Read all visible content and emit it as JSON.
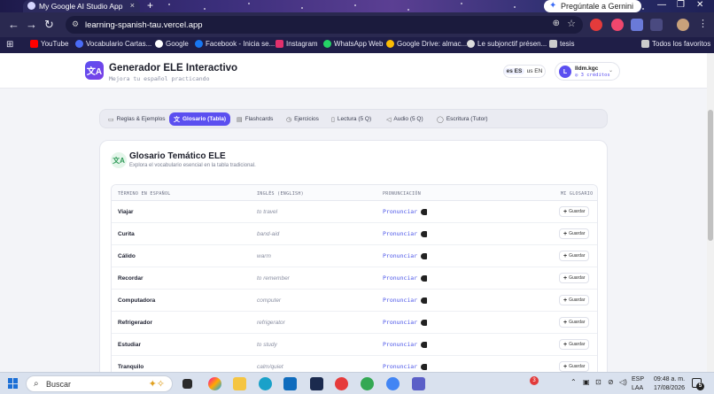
{
  "browser": {
    "tab_title": "My Google AI Studio App",
    "tab_close": "×",
    "new_tab": "+",
    "gemini_button": "Pregúntale a Gemini",
    "url": "learning-spanish-tau.vercel.app",
    "bookmarks": [
      {
        "label": "YouTube",
        "color": "#ff0000"
      },
      {
        "label": "Vocabulario Cartas...",
        "color": "#4a6cf7"
      },
      {
        "label": "Google",
        "color": "#ffffff"
      },
      {
        "label": "Facebook - Inicia se...",
        "color": "#1877f2"
      },
      {
        "label": "Instagram",
        "color": "#e1306c"
      },
      {
        "label": "WhatsApp Web",
        "color": "#25d366"
      },
      {
        "label": "Google Drive: almac...",
        "color": "#fbbc04"
      },
      {
        "label": "Le subjonctif présen...",
        "color": "#dddddd"
      },
      {
        "label": "tesis",
        "color": "#cccccc"
      }
    ],
    "all_bookmarks": "Todos los favoritos"
  },
  "app": {
    "title": "Generador ELE Interactivo",
    "subtitle": "Mejora tu español practicando",
    "logo_glyph": "文A",
    "lang_es": "es ES",
    "lang_en": "us EN",
    "user_initial": "L",
    "user_name": "lldm.kgc",
    "user_credits": "◎ 3 créditos",
    "accent": "#5b4ff0"
  },
  "tabs": [
    {
      "label": "Reglas & Ejemplos",
      "icon": "▭",
      "active": false
    },
    {
      "label": "Glosario (Tabla)",
      "icon": "文",
      "active": true
    },
    {
      "label": "Flashcards",
      "icon": "▤",
      "active": false
    },
    {
      "label": "Ejercicios",
      "icon": "◷",
      "active": false
    },
    {
      "label": "Lectura (5 Q)",
      "icon": "▯",
      "active": false
    },
    {
      "label": "Audio (5 Q)",
      "icon": "◁",
      "active": false
    },
    {
      "label": "Escritura (Tutor)",
      "icon": "◯",
      "active": false
    }
  ],
  "glossary": {
    "icon_glyph": "文A",
    "title": "Glosario Temático ELE",
    "subtitle": "Explora el vocabulario esencial en la tabla tradicional.",
    "headers": {
      "es": "TÉRMINO EN ESPAÑOL",
      "en": "INGLÉS (ENGLISH)",
      "pron": "PRONUNCIACIÓN",
      "mine": "MI GLOSARIO"
    },
    "pronounce_label": "Pronunciar",
    "save_label": "Guardar",
    "rows": [
      {
        "es": "Viajar",
        "en": "to travel"
      },
      {
        "es": "Curita",
        "en": "band-aid"
      },
      {
        "es": "Cálido",
        "en": "warm"
      },
      {
        "es": "Recordar",
        "en": "to remember"
      },
      {
        "es": "Computadora",
        "en": "computer"
      },
      {
        "es": "Refrigerador",
        "en": "refrigerator"
      },
      {
        "es": "Estudiar",
        "en": "to study"
      },
      {
        "es": "Tranquilo",
        "en": "calm/quiet"
      }
    ]
  },
  "taskbar": {
    "search_placeholder": "Buscar",
    "lang_top": "ESP",
    "lang_bottom": "LAA",
    "time": "09:48 a. m.",
    "date": "17/08/2026",
    "notif_count": "5",
    "badge_count": "3"
  }
}
